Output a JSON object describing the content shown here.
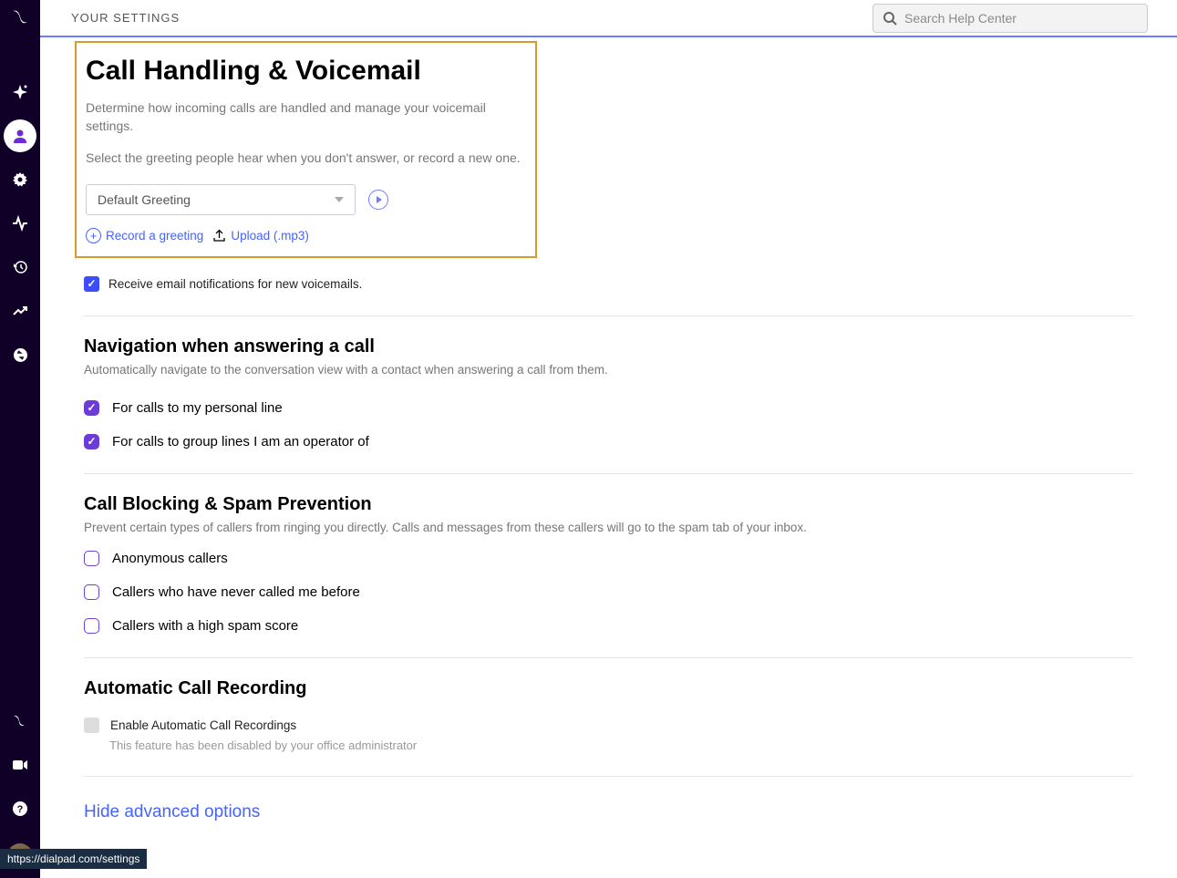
{
  "header": {
    "title": "YOUR SETTINGS",
    "search_placeholder": "Search Help Center"
  },
  "voicemail": {
    "title": "Call Handling & Voicemail",
    "desc1": "Determine how incoming calls are handled and manage your voicemail settings.",
    "desc2": "Select the greeting people hear when you don't answer, or record a new one.",
    "greeting_selected": "Default Greeting",
    "record_link": "Record a greeting",
    "upload_link": "Upload (.mp3)",
    "email_notify": "Receive email notifications for new voicemails."
  },
  "navigation": {
    "title": "Navigation when answering a call",
    "desc": "Automatically navigate to the conversation view with a contact when answering a call from them.",
    "opt1": "For calls to my personal line",
    "opt2": "For calls to group lines I am an operator of"
  },
  "blocking": {
    "title": "Call Blocking & Spam Prevention",
    "desc": "Prevent certain types of callers from ringing you directly. Calls and messages from these callers will go to the spam tab of your inbox.",
    "opt1": "Anonymous callers",
    "opt2": "Callers who have never called me before",
    "opt3": "Callers with a high spam score"
  },
  "recording": {
    "title": "Automatic Call Recording",
    "enable": "Enable Automatic Call Recordings",
    "disabled_note": "This feature has been disabled by your office administrator"
  },
  "advanced_link": "Hide advanced options",
  "url_hint": "https://dialpad.com/settings"
}
